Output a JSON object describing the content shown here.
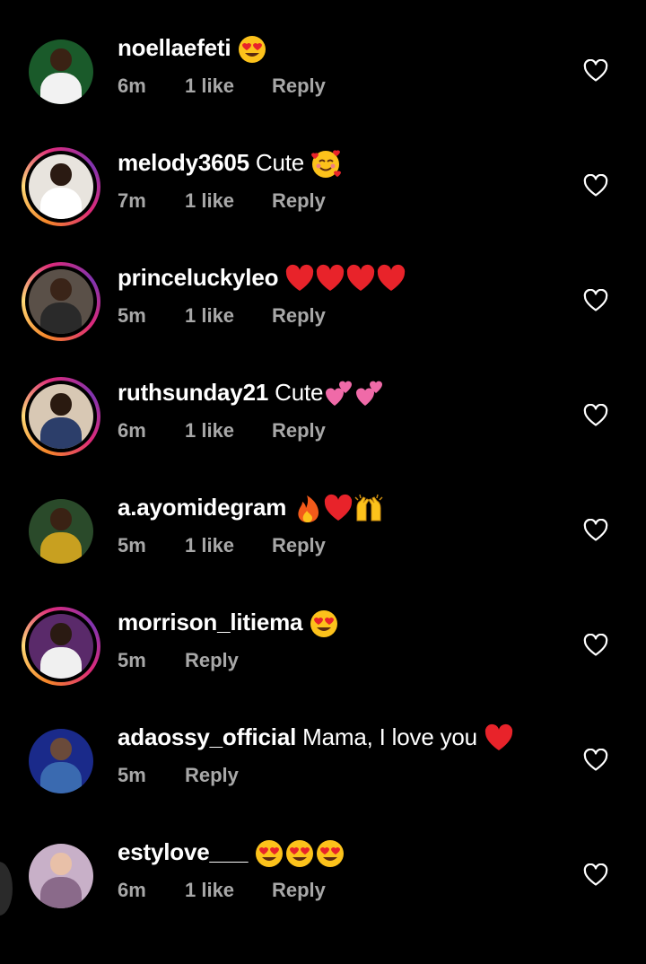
{
  "colors": {
    "background": "#000000",
    "text": "#ffffff",
    "meta": "#a8a8a8",
    "heart": "#e8232a",
    "story_ring": [
      "#f58529",
      "#feda77",
      "#dd2a7b",
      "#8134af"
    ]
  },
  "comments": [
    {
      "username": "noellaefeti",
      "text": "",
      "emojis": [
        "heart-eyes"
      ],
      "time": "6m",
      "likes": "1 like",
      "reply": "Reply",
      "has_story_ring": false,
      "avatar_colors": [
        "#1a5a2a",
        "#3a2214",
        "#f2f2f2"
      ]
    },
    {
      "username": "melody3605",
      "text": "Cute",
      "emojis": [
        "smiling-face-with-hearts"
      ],
      "time": "7m",
      "likes": "1 like",
      "reply": "Reply",
      "has_story_ring": true,
      "avatar_colors": [
        "#e8e4de",
        "#2a1a12",
        "#ffffff"
      ]
    },
    {
      "username": "princeluckyleo",
      "text": "",
      "emojis": [
        "red-heart",
        "red-heart",
        "red-heart",
        "red-heart"
      ],
      "time": "5m",
      "likes": "1 like",
      "reply": "Reply",
      "has_story_ring": true,
      "avatar_colors": [
        "#5a5048",
        "#3a2418",
        "#2a2a2a"
      ]
    },
    {
      "username": "ruthsunday21",
      "text": "Cute",
      "emojis": [
        "two-hearts",
        "two-hearts"
      ],
      "time": "6m",
      "likes": "1 like",
      "reply": "Reply",
      "has_story_ring": true,
      "avatar_colors": [
        "#d8c8b4",
        "#2a1a10",
        "#2c3e6a"
      ]
    },
    {
      "username": "a.ayomidegram",
      "text": "",
      "emojis": [
        "fire",
        "red-heart",
        "raising-hands"
      ],
      "time": "5m",
      "likes": "1 like",
      "reply": "Reply",
      "has_story_ring": false,
      "avatar_colors": [
        "#2a4a2a",
        "#3a2214",
        "#c8a020"
      ]
    },
    {
      "username": "morrison_litiema",
      "text": "",
      "emojis": [
        "heart-eyes"
      ],
      "time": "5m",
      "likes": "",
      "reply": "Reply",
      "has_story_ring": true,
      "avatar_colors": [
        "#5a2a6a",
        "#2a1a12",
        "#f0f0f0"
      ]
    },
    {
      "username": "adaossy_official",
      "text": "Mama, I love you",
      "emojis": [
        "red-heart"
      ],
      "time": "5m",
      "likes": "",
      "reply": "Reply",
      "has_story_ring": false,
      "avatar_colors": [
        "#1a2a8a",
        "#6a4a3a",
        "#3a6ab0"
      ]
    },
    {
      "username": "estylove___",
      "text": "",
      "emojis": [
        "heart-eyes",
        "heart-eyes",
        "heart-eyes"
      ],
      "time": "6m",
      "likes": "1 like",
      "reply": "Reply",
      "has_story_ring": false,
      "avatar_colors": [
        "#c8b0c8",
        "#e8c0a8",
        "#8a6a8a"
      ]
    }
  ]
}
